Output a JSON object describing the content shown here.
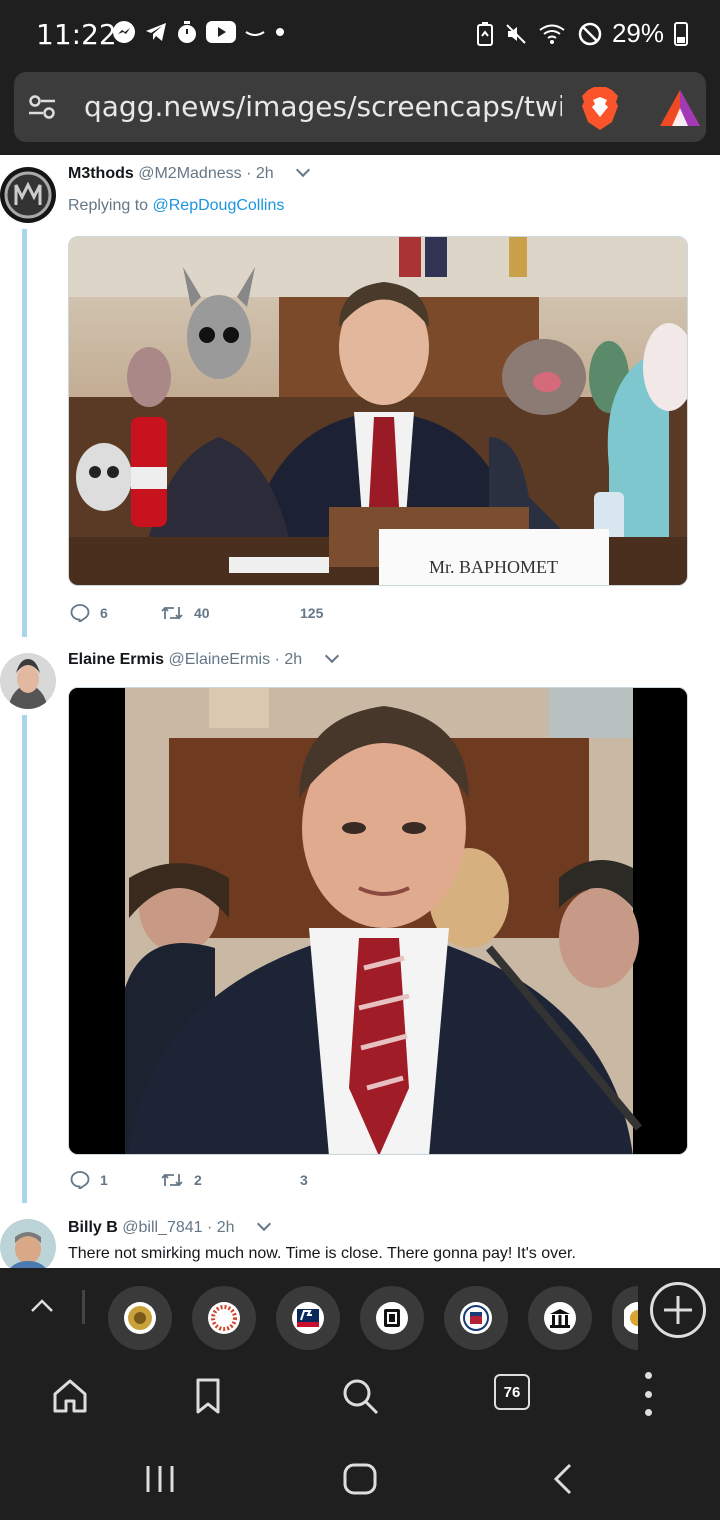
{
  "status": {
    "time": "11:22",
    "battery": "29%",
    "left_icons": [
      "messenger-icon",
      "telegram-icon",
      "timer-icon",
      "youtube-icon",
      "dash-icon",
      "dot-icon"
    ],
    "right_icons": [
      "battery-saver-icon",
      "mute-icon",
      "wifi-calling-icon",
      "dnd-icon"
    ]
  },
  "browser": {
    "url": "qagg.news/images/screencaps/twitte",
    "tab_count": "76"
  },
  "tweets": [
    {
      "name": "M3thods",
      "handle": "@M2Madness",
      "time": "· 2h",
      "replying_prefix": "Replying to",
      "replying_to": "@RepDougCollins",
      "media_label": "Mr. BAPHOMET",
      "replies": "6",
      "retweets": "40",
      "likes": "125"
    },
    {
      "name": "Elaine Ermis",
      "handle": "@ElaineErmis",
      "time": "· 2h",
      "replies": "1",
      "retweets": "2",
      "likes": "3"
    },
    {
      "name": "Billy B",
      "handle": "@bill_7841",
      "time": "· 2h",
      "text": "There not smirking much now. Time is close. There gonna pay! It's over."
    }
  ],
  "tabstrip": {
    "favicons": [
      "gold-seal-icon",
      "dotted-circle-icon",
      "fox-news-icon",
      "book-icon",
      "seal-icon",
      "courthouse-icon",
      "partial-icon"
    ]
  },
  "colors": {
    "accent_blue": "#1b95e0",
    "thread_line": "#a7d6ec",
    "chrome_dark": "#1f1f1f"
  }
}
